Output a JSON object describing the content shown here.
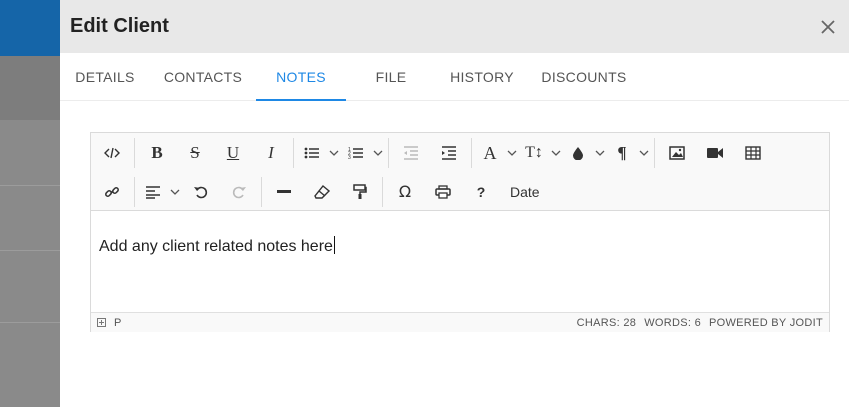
{
  "modal": {
    "title": "Edit Client"
  },
  "tabs": [
    {
      "label": "DETAILS"
    },
    {
      "label": "CONTACTS"
    },
    {
      "label": "NOTES"
    },
    {
      "label": "FILE"
    },
    {
      "label": "HISTORY"
    },
    {
      "label": "DISCOUNTS"
    }
  ],
  "active_tab": "NOTES",
  "editor": {
    "content": "Add any client related notes here",
    "date_label": "Date",
    "status": {
      "path": "P",
      "chars": "CHARS: 28",
      "words": "WORDS: 6",
      "powered": "POWERED BY JODIT"
    }
  },
  "colors": {
    "accent": "#1e88e5",
    "header_bg": "#e8e8e8",
    "toolbar_bg": "#f9f9f9",
    "app_bar": "#1565a8"
  },
  "icons": [
    "close-icon",
    "source-icon",
    "bold-icon",
    "strikethrough-icon",
    "underline-icon",
    "italic-icon",
    "bullet-list-icon",
    "numbered-list-icon",
    "outdent-icon",
    "indent-icon",
    "font-icon",
    "font-size-icon",
    "brush-icon",
    "paragraph-icon",
    "image-icon",
    "video-icon",
    "table-icon",
    "link-icon",
    "align-icon",
    "undo-icon",
    "redo-icon",
    "horizontal-line-icon",
    "eraser-icon",
    "copy-format-icon",
    "symbol-icon",
    "print-icon",
    "help-icon",
    "resize-icon"
  ]
}
